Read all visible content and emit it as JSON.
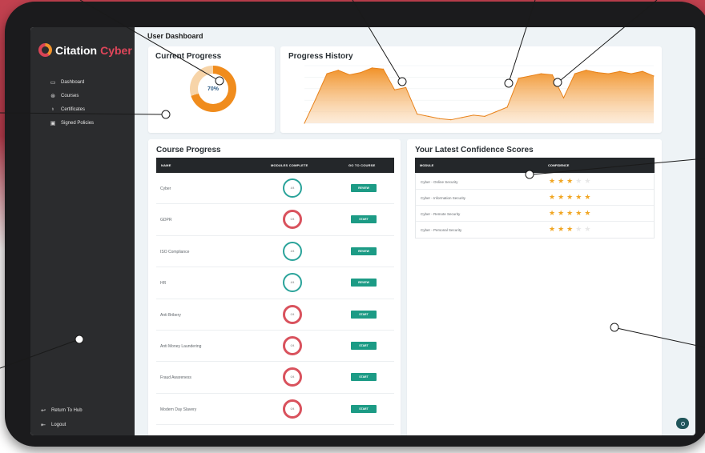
{
  "app": {
    "logo_primary": "Citation",
    "logo_accent": "Cyber"
  },
  "sidebar": {
    "items": [
      {
        "label": "Dashboard",
        "icon": "dashboard-icon",
        "glyph": "▭"
      },
      {
        "label": "Courses",
        "icon": "courses-icon",
        "glyph": "⊛"
      },
      {
        "label": "Certificates",
        "icon": "certificate-icon",
        "glyph": "♁"
      },
      {
        "label": "Signed Policies",
        "icon": "policy-icon",
        "glyph": "▣"
      }
    ],
    "bottom": [
      {
        "label": "Return To Hub",
        "icon": "return-icon",
        "glyph": "↩"
      },
      {
        "label": "Logout",
        "icon": "logout-icon",
        "glyph": "⇤"
      }
    ]
  },
  "page": {
    "title": "User Dashboard"
  },
  "current_progress": {
    "title": "Current Progress",
    "percent_label": "70%",
    "fraction": 0.7
  },
  "progress_history": {
    "title": "Progress History"
  },
  "chart_data": {
    "type": "area",
    "title": "Progress History",
    "values": [
      0,
      42,
      86,
      92,
      84,
      88,
      96,
      94,
      58,
      62,
      16,
      12,
      8,
      6,
      10,
      14,
      12,
      20,
      28,
      78,
      82,
      86,
      84,
      44,
      86,
      92,
      88,
      86,
      90,
      86,
      90,
      82
    ],
    "ylim": [
      0,
      100
    ],
    "grid": true
  },
  "course_progress": {
    "title": "Course Progress",
    "columns": [
      "NAME",
      "MODULES COMPLETE",
      "GO TO COURSE"
    ],
    "rows": [
      {
        "name": "Cyber",
        "modules": "4/4",
        "status": "complete",
        "action": "REVIEW"
      },
      {
        "name": "GDPR",
        "modules": "0/4",
        "status": "incomplete",
        "action": "START"
      },
      {
        "name": "ISO Compliance",
        "modules": "4/4",
        "status": "complete",
        "action": "REVIEW"
      },
      {
        "name": "HR",
        "modules": "4/4",
        "status": "complete",
        "action": "REVIEW"
      },
      {
        "name": "Anti Bribery",
        "modules": "0/4",
        "status": "incomplete",
        "action": "START"
      },
      {
        "name": "Anti Money Laundering",
        "modules": "0/4",
        "status": "incomplete",
        "action": "START"
      },
      {
        "name": "Fraud Awareness",
        "modules": "0/4",
        "status": "incomplete",
        "action": "START"
      },
      {
        "name": "Modern Day Slavery",
        "modules": "0/4",
        "status": "incomplete",
        "action": "START"
      }
    ]
  },
  "confidence": {
    "title": "Your Latest Confidence Scores",
    "columns": [
      "MODULE",
      "CONFIDENCE"
    ],
    "rows": [
      {
        "module": "Cyber - Online Security",
        "stars": 3
      },
      {
        "module": "Cyber - Information Security",
        "stars": 5
      },
      {
        "module": "Cyber - Remote Security",
        "stars": 5
      },
      {
        "module": "Cyber - Personal Security",
        "stars": 3
      }
    ],
    "max_stars": 5
  },
  "colors": {
    "sidebar": "#2b2c2e",
    "accent_orange": "#f08c1d",
    "brand_red": "#e0465a",
    "button_teal": "#1c9b85",
    "ring_teal": "#2aa39a",
    "ring_red": "#d9525d",
    "star": "#f1a623"
  }
}
